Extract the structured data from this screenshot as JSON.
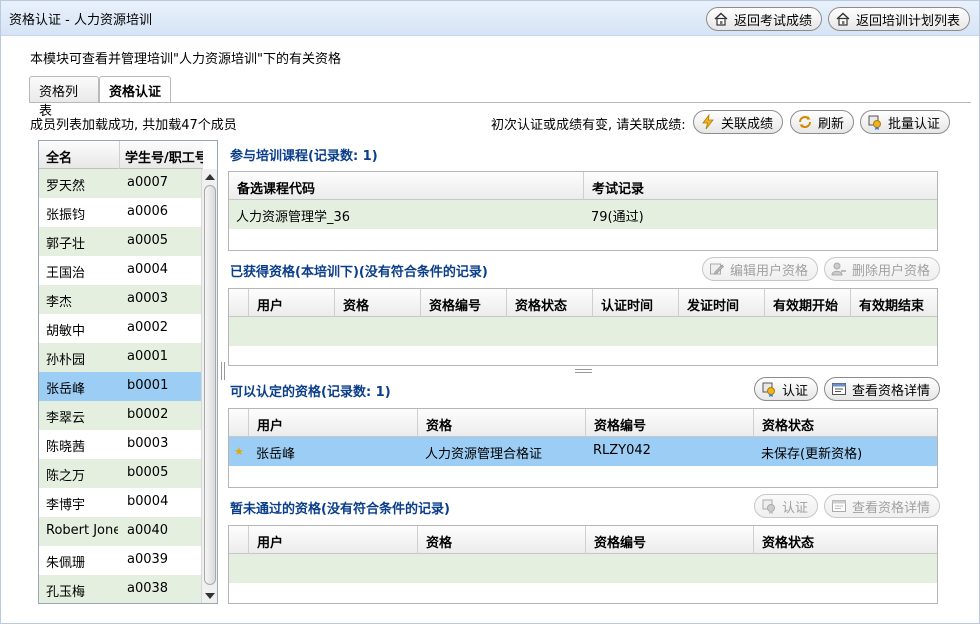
{
  "window": {
    "title": "资格认证 - 人力资源培训"
  },
  "header": {
    "back_exam_label": "返回考试成绩",
    "back_plan_label": "返回培训计划列表"
  },
  "description": "本模块可查看并管理培训\"人力资源培训\"下的有关资格",
  "tabs": [
    {
      "label": "资格列表"
    },
    {
      "label": "资格认证"
    }
  ],
  "toolbar": {
    "status": "成员列表加载成功, 共加载47个成员",
    "hint": "初次认证或成绩有变, 请关联成绩:",
    "link_label": "关联成绩",
    "refresh_label": "刷新",
    "batch_label": "批量认证"
  },
  "members": {
    "columns": [
      "全名",
      "学生号/职工号"
    ],
    "rows": [
      {
        "name": "罗天然",
        "id": "a0007"
      },
      {
        "name": "张振钧",
        "id": "a0006"
      },
      {
        "name": "郭子壮",
        "id": "a0005"
      },
      {
        "name": "王国治",
        "id": "a0004"
      },
      {
        "name": "李杰",
        "id": "a0003"
      },
      {
        "name": "胡敏中",
        "id": "a0002"
      },
      {
        "name": "孙朴园",
        "id": "a0001"
      },
      {
        "name": "张岳峰",
        "id": "b0001"
      },
      {
        "name": "李翠云",
        "id": "b0002"
      },
      {
        "name": "陈晓茜",
        "id": "b0003"
      },
      {
        "name": "陈之万",
        "id": "b0005"
      },
      {
        "name": "李博宇",
        "id": "b0004"
      },
      {
        "name": "Robert Jones",
        "id": "a0040"
      },
      {
        "name": "朱佩珊",
        "id": "a0039"
      },
      {
        "name": "孔玉梅",
        "id": "a0038"
      }
    ],
    "selected_index": 7
  },
  "courses": {
    "title": "参与培训课程(记录数: 1)",
    "columns": [
      "备选课程代码",
      "考试记录"
    ],
    "rows": [
      {
        "code": "人力资源管理学_36",
        "record": "79(通过)"
      }
    ]
  },
  "obtained": {
    "title": "已获得资格(本培训下)(没有符合条件的记录)",
    "edit_label": "编辑用户资格",
    "delete_label": "删除用户资格",
    "columns": [
      "用户",
      "资格",
      "资格编号",
      "资格状态",
      "认证时间",
      "发证时间",
      "有效期开始",
      "有效期结束"
    ]
  },
  "certifiable": {
    "title": "可以认定的资格(记录数: 1)",
    "certify_label": "认证",
    "detail_label": "查看资格详情",
    "columns": [
      "用户",
      "资格",
      "资格编号",
      "资格状态"
    ],
    "rows": [
      {
        "marker": "★",
        "user": "张岳峰",
        "qual": "人力资源管理合格证",
        "code": "RLZY042",
        "status": "未保存(更新资格)"
      }
    ]
  },
  "failed": {
    "title": "暂未通过的资格(没有符合条件的记录)",
    "certify_label": "认证",
    "detail_label": "查看资格详情",
    "columns": [
      "用户",
      "资格",
      "资格编号",
      "资格状态"
    ]
  },
  "colors": {
    "header_bg": "#d6e4f5",
    "row_alt": "#e4efe0",
    "row_selected": "#9ccdf4",
    "section_title": "#0b3e8a"
  }
}
